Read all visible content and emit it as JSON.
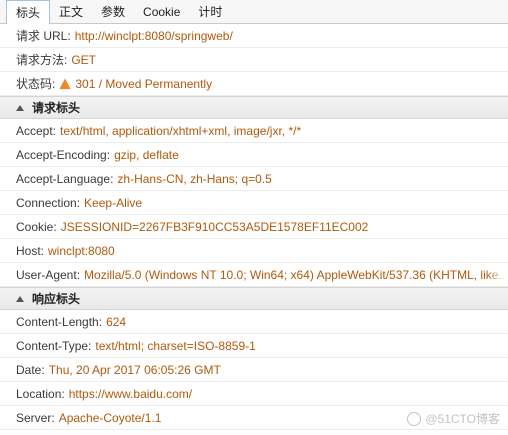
{
  "tabs": [
    "标头",
    "正文",
    "参数",
    "Cookie",
    "计时"
  ],
  "general": [
    {
      "key": "请求 URL:",
      "value": "http://winclpt:8080/springweb/"
    },
    {
      "key": "请求方法:",
      "value": "GET"
    },
    {
      "key": "状态码:",
      "value": "301 / Moved Permanently",
      "icon": "warning-triangle-icon"
    }
  ],
  "request_headers": {
    "title": "请求标头",
    "items": [
      {
        "key": "Accept:",
        "value": "text/html, application/xhtml+xml, image/jxr, */*"
      },
      {
        "key": "Accept-Encoding:",
        "value": "gzip, deflate"
      },
      {
        "key": "Accept-Language:",
        "value": "zh-Hans-CN, zh-Hans; q=0.5"
      },
      {
        "key": "Connection:",
        "value": "Keep-Alive"
      },
      {
        "key": "Cookie:",
        "value": "JSESSIONID=2267FB3F910CC53A5DE1578EF11EC002"
      },
      {
        "key": "Host:",
        "value": "winclpt:8080"
      },
      {
        "key": "User-Agent:",
        "value": "Mozilla/5.0 (Windows NT 10.0; Win64; x64) AppleWebKit/537.36 (KHTML, like..."
      }
    ]
  },
  "response_headers": {
    "title": "响应标头",
    "items": [
      {
        "key": "Content-Length:",
        "value": "624"
      },
      {
        "key": "Content-Type:",
        "value": "text/html; charset=ISO-8859-1"
      },
      {
        "key": "Date:",
        "value": "Thu, 20 Apr 2017 06:05:26 GMT"
      },
      {
        "key": "Location:",
        "value": "https://www.baidu.com/"
      },
      {
        "key": "Server:",
        "value": "Apache-Coyote/1.1"
      }
    ]
  },
  "watermark": "@51CTO博客",
  "colors": {
    "value": "#b05a0c",
    "warning": "#f0862a",
    "tab_active_border": "#9fc4e6"
  }
}
